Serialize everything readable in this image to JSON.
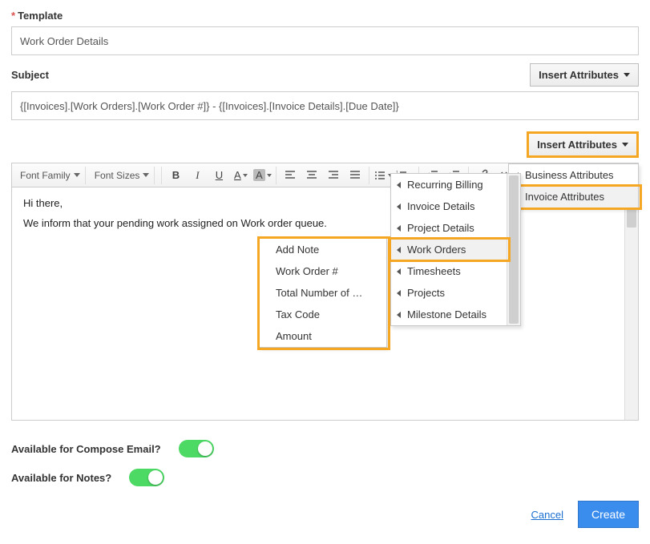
{
  "labels": {
    "template": "Template",
    "subject": "Subject",
    "insert_attributes": "Insert Attributes",
    "available_email": "Available for Compose Email?",
    "available_notes": "Available for Notes?",
    "cancel": "Cancel",
    "create": "Create"
  },
  "template_name": "Work Order Details",
  "subject_value": "{[Invoices].[Work Orders].[Work Order #]} - {[Invoices].[Invoice Details].[Due Date]}",
  "toolbar": {
    "font_family": "Font Family",
    "font_sizes": "Font Sizes"
  },
  "body_lines": {
    "l1": "Hi there,",
    "l2": "We inform that your pending work assigned on Work order queue."
  },
  "attr_menu_root": {
    "0": "Business Attributes",
    "1": "Invoice Attributes"
  },
  "attr_menu_invoice": {
    "0": "Recurring Billing",
    "1": "Invoice Details",
    "2": "Project Details",
    "3": "Work Orders",
    "4": "Timesheets",
    "5": "Projects",
    "6": "Milestone Details"
  },
  "attr_menu_workorders": {
    "0": "Add Note",
    "1": "Work Order #",
    "2": "Total Number of …",
    "3": "Tax Code",
    "4": "Amount"
  },
  "toggles": {
    "email": true,
    "notes": true
  }
}
